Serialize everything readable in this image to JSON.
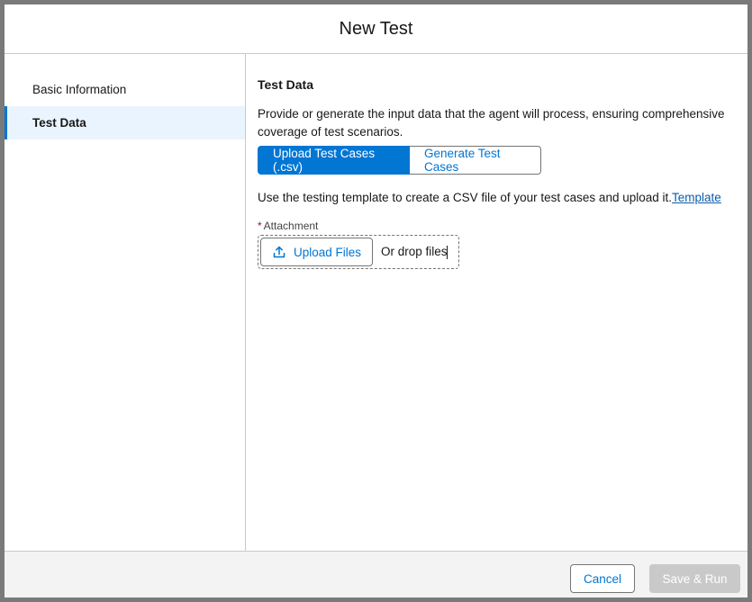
{
  "modal": {
    "title": "New Test"
  },
  "sidebar": {
    "items": [
      {
        "label": "Basic Information"
      },
      {
        "label": "Test Data"
      }
    ]
  },
  "content": {
    "heading": "Test Data",
    "description": "Provide or generate the input data that the agent will process, ensuring comprehensive coverage of test scenarios.",
    "tabs": [
      {
        "label": "Upload Test Cases (.csv)",
        "selected": true
      },
      {
        "label": "Generate Test Cases",
        "selected": false
      }
    ],
    "template_text": "Use the testing template to create a CSV file of your test cases and upload it.",
    "template_link": "Template",
    "attachment": {
      "required_marker": "*",
      "label": "Attachment",
      "upload_button": "Upload Files",
      "upload_icon": "upload-icon",
      "drop_text": "Or drop files"
    }
  },
  "footer": {
    "cancel_label": "Cancel",
    "save_label": "Save & Run"
  },
  "colors": {
    "brand": "#0176d3",
    "active_nav_bg": "#eaf4fe",
    "disabled": "#c9c9c9",
    "required": "#ba0517"
  }
}
